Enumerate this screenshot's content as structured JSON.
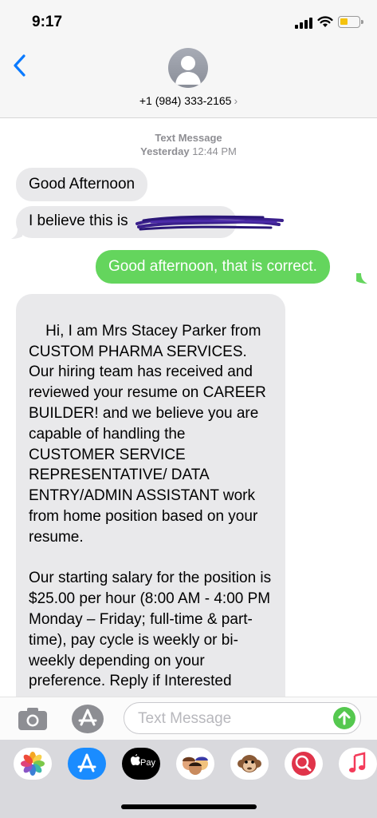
{
  "status_bar": {
    "time": "9:17"
  },
  "header": {
    "contact_number": "+1 (984) 333-2165",
    "chevron": "›"
  },
  "thread": {
    "meta_label": "Text Message",
    "meta_day": "Yesterday",
    "meta_time": "12:44 PM",
    "messages": [
      {
        "direction": "incoming",
        "text": "Good Afternoon"
      },
      {
        "direction": "incoming",
        "text": "I believe this is"
      },
      {
        "direction": "outgoing",
        "text": "Good afternoon, that is correct."
      },
      {
        "direction": "incoming",
        "text": "Hi, I am Mrs Stacey Parker from CUSTOM PHARMA SERVICES. Our hiring team has received and reviewed your resume on CAREER BUILDER! and we believe you are capable of handling the CUSTOMER SERVICE REPRESENTATIVE/ DATA ENTRY/ADMIN ASSISTANT work from home position based on your resume.\n\nOur starting salary for the position is $25.00 per hour (8:00 AM - 4:00 PM Monday – Friday; full-time & part-time), pay cycle is weekly or bi-weekly depending on your preference. Reply if Interested"
      }
    ]
  },
  "input_bar": {
    "placeholder": "Text Message",
    "icons": [
      "camera-icon",
      "app-store-icon",
      "send-arrow-icon"
    ]
  },
  "app_drawer": {
    "apps": [
      {
        "name": "photos-icon"
      },
      {
        "name": "app-store-icon"
      },
      {
        "name": "apple-pay-icon",
        "label": "Pay"
      },
      {
        "name": "memoji-icon"
      },
      {
        "name": "animoji-monkey-icon"
      },
      {
        "name": "web-search-icon"
      },
      {
        "name": "music-icon"
      }
    ]
  },
  "colors": {
    "ios_blue": "#0a7aff",
    "outgoing_bubble": "#64d55d",
    "incoming_bubble": "#e9e9eb",
    "redaction": "#3a1f8c"
  }
}
